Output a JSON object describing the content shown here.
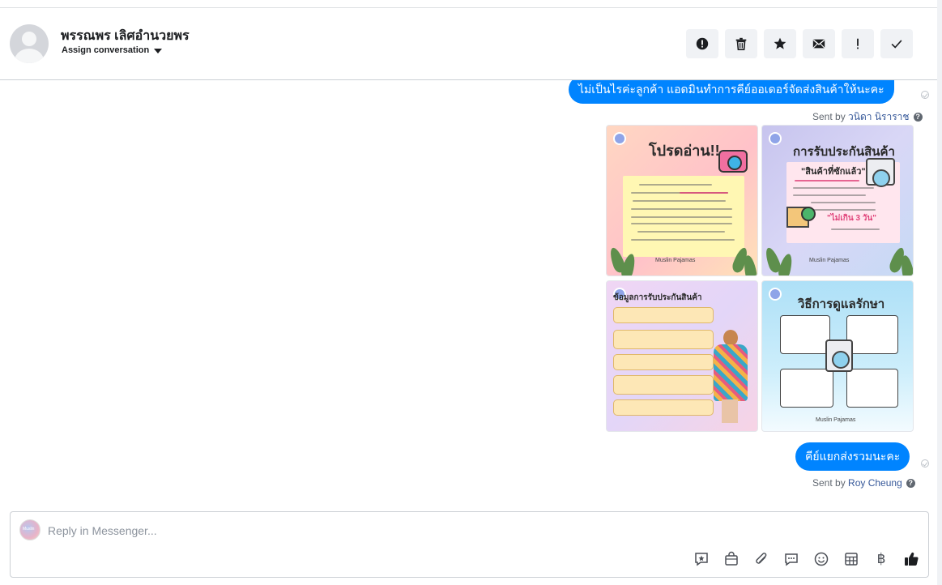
{
  "header": {
    "contact_name": "พรรณพร เลิศอำนวยพร",
    "assign_label": "Assign conversation",
    "actions": [
      {
        "name": "mark-spam-button",
        "icon": "exclamation-circle-icon"
      },
      {
        "name": "delete-button",
        "icon": "trash-icon"
      },
      {
        "name": "star-button",
        "icon": "star-icon"
      },
      {
        "name": "mark-unread-button",
        "icon": "envelope-icon"
      },
      {
        "name": "follow-up-button",
        "icon": "exclamation-icon"
      },
      {
        "name": "mark-done-button",
        "icon": "check-icon"
      }
    ]
  },
  "conversation": {
    "message_1": {
      "text": "ไม่เป็นไรค่ะลูกค้า แอดมินทำการคีย์ออเดอร์จัดส่งสินค้าให้นะคะ",
      "sent_by_prefix": "Sent by",
      "sender": "วนิดา นิราราช"
    },
    "images": {
      "tile_1": {
        "title": "โปรดอ่าน!!",
        "brand": "Muslin Pajamas"
      },
      "tile_2": {
        "title": "การรับประกันสินค้า",
        "subtitle": "\"สินค้าที่ซักแล้ว\"",
        "highlight": "\"ไม่เกิน 3 วัน\"",
        "brand": "Muslin Pajamas"
      },
      "tile_3": {
        "title": "ข้อมูลการรับประกันสินค้า"
      },
      "tile_4": {
        "title": "วิธีการดูแลรักษา",
        "brand": "Muslin Pajamas"
      }
    },
    "message_2": {
      "text": "คีย์แยกส่งรวมนะคะ",
      "sent_by_prefix": "Sent by",
      "sender": "Roy Cheung"
    }
  },
  "composer": {
    "placeholder": "Reply in Messenger...",
    "page_avatar_text": "Muslin",
    "tools": [
      "saved-reply-icon",
      "shop-bag-icon",
      "paperclip-icon",
      "chat-bubble-icon",
      "emoji-icon",
      "table-icon",
      "baht-icon",
      "thumbs-up-icon"
    ],
    "currency_symbol": "฿"
  }
}
